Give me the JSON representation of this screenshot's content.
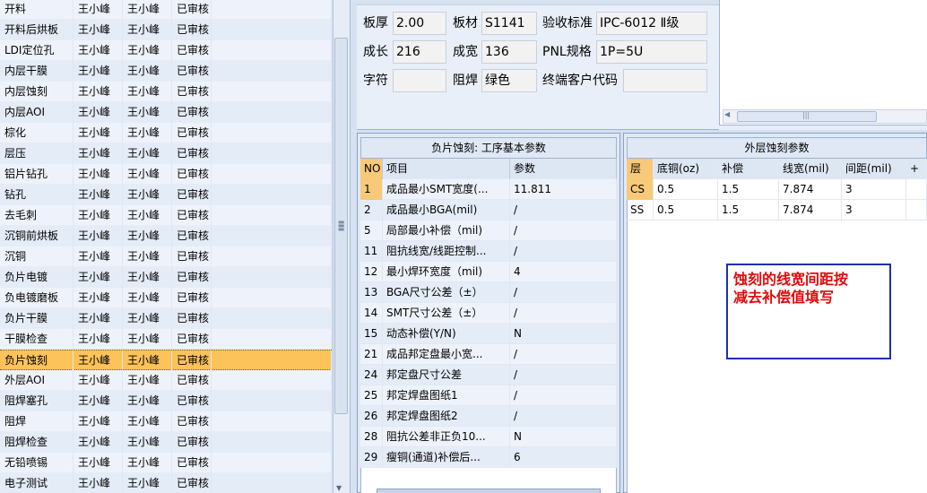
{
  "process_list": {
    "rows": [
      {
        "name": "开料",
        "user1": "王小峰",
        "user2": "王小峰",
        "status": "已审核"
      },
      {
        "name": "开料后烘板",
        "user1": "王小峰",
        "user2": "王小峰",
        "status": "已审核"
      },
      {
        "name": "LDI定位孔",
        "user1": "王小峰",
        "user2": "王小峰",
        "status": "已审核"
      },
      {
        "name": "内层干膜",
        "user1": "王小峰",
        "user2": "王小峰",
        "status": "已审核"
      },
      {
        "name": "内层蚀刻",
        "user1": "王小峰",
        "user2": "王小峰",
        "status": "已审核"
      },
      {
        "name": "内层AOI",
        "user1": "王小峰",
        "user2": "王小峰",
        "status": "已审核"
      },
      {
        "name": "棕化",
        "user1": "王小峰",
        "user2": "王小峰",
        "status": "已审核"
      },
      {
        "name": "层压",
        "user1": "王小峰",
        "user2": "王小峰",
        "status": "已审核"
      },
      {
        "name": "铝片钻孔",
        "user1": "王小峰",
        "user2": "王小峰",
        "status": "已审核"
      },
      {
        "name": "钻孔",
        "user1": "王小峰",
        "user2": "王小峰",
        "status": "已审核"
      },
      {
        "name": "去毛刺",
        "user1": "王小峰",
        "user2": "王小峰",
        "status": "已审核"
      },
      {
        "name": "沉铜前烘板",
        "user1": "王小峰",
        "user2": "王小峰",
        "status": "已审核"
      },
      {
        "name": "沉铜",
        "user1": "王小峰",
        "user2": "王小峰",
        "status": "已审核"
      },
      {
        "name": "负片电镀",
        "user1": "王小峰",
        "user2": "王小峰",
        "status": "已审核"
      },
      {
        "name": "负电镀磨板",
        "user1": "王小峰",
        "user2": "王小峰",
        "status": "已审核"
      },
      {
        "name": "负片干膜",
        "user1": "王小峰",
        "user2": "王小峰",
        "status": "已审核"
      },
      {
        "name": "干膜检查",
        "user1": "王小峰",
        "user2": "王小峰",
        "status": "已审核"
      },
      {
        "name": "负片蚀刻",
        "user1": "王小峰",
        "user2": "王小峰",
        "status": "已审核"
      },
      {
        "name": "外层AOI",
        "user1": "王小峰",
        "user2": "王小峰",
        "status": "已审核"
      },
      {
        "name": "阻焊塞孔",
        "user1": "王小峰",
        "user2": "王小峰",
        "status": "已审核"
      },
      {
        "name": "阻焊",
        "user1": "王小峰",
        "user2": "王小峰",
        "status": "已审核"
      },
      {
        "name": "阻焊检查",
        "user1": "王小峰",
        "user2": "王小峰",
        "status": "已审核"
      },
      {
        "name": "无铅喷锡",
        "user1": "王小峰",
        "user2": "王小峰",
        "status": "已审核"
      },
      {
        "name": "电子测试",
        "user1": "王小峰",
        "user2": "王小峰",
        "status": "已审核"
      }
    ],
    "selected_index": 17
  },
  "board_info": {
    "thickness_label": "板厚",
    "thickness": "2.00",
    "material_label": "板材",
    "material": "S1141",
    "standard_label": "验收标准",
    "standard": "IPC-6012 Ⅱ级",
    "length_label": "成长",
    "length": "216",
    "width_label": "成宽",
    "width": "136",
    "pnl_label": "PNL规格",
    "pnl": "1P=5U",
    "legend_label": "字符",
    "legend": "",
    "solder_label": "阻焊",
    "solder": "绿色",
    "customer_label": "终端客户代码",
    "customer": ""
  },
  "process_params": {
    "title": "负片蚀刻: 工序基本参数",
    "headers": {
      "no": "NO",
      "item": "项目",
      "value": "参数"
    },
    "rows": [
      {
        "no": "1",
        "item": "成品最小SMT宽度(...",
        "value": "11.811"
      },
      {
        "no": "2",
        "item": "成品最小BGA(mil)",
        "value": "/"
      },
      {
        "no": "5",
        "item": "局部最小补偿（mil)",
        "value": "/"
      },
      {
        "no": "11",
        "item": "阻抗线宽/线距控制...",
        "value": "/"
      },
      {
        "no": "12",
        "item": "最小焊环宽度（mil)",
        "value": "4"
      },
      {
        "no": "13",
        "item": "BGA尺寸公差（±）",
        "value": "/"
      },
      {
        "no": "14",
        "item": "SMT尺寸公差（±）",
        "value": "/"
      },
      {
        "no": "15",
        "item": "动态补偿(Y/N)",
        "value": "N"
      },
      {
        "no": "21",
        "item": "成品邦定盘最小宽...",
        "value": "/"
      },
      {
        "no": "24",
        "item": "邦定盘尺寸公差",
        "value": "/"
      },
      {
        "no": "25",
        "item": "邦定焊盘图纸1",
        "value": "/"
      },
      {
        "no": "26",
        "item": "邦定焊盘图纸2",
        "value": "/"
      },
      {
        "no": "28",
        "item": "阻抗公差非正负10...",
        "value": "N"
      },
      {
        "no": "29",
        "item": "瘦铜(通道)补偿后...",
        "value": "6"
      }
    ]
  },
  "outer_etch_params": {
    "title": "外层蚀刻参数",
    "headers": {
      "layer": "层",
      "base_copper": "底铜(oz)",
      "compensation": "补偿",
      "line_width": "线宽(mil)",
      "spacing": "间距(mil)",
      "more": "+"
    },
    "rows": [
      {
        "layer": "CS",
        "base_copper": "0.5",
        "compensation": "1.5",
        "line_width": "7.874",
        "spacing": "3"
      },
      {
        "layer": "SS",
        "base_copper": "0.5",
        "compensation": "1.5",
        "line_width": "7.874",
        "spacing": "3"
      }
    ]
  },
  "annotation": {
    "line1": "蚀刻的线宽间距按",
    "line2": "减去补偿值填写"
  }
}
